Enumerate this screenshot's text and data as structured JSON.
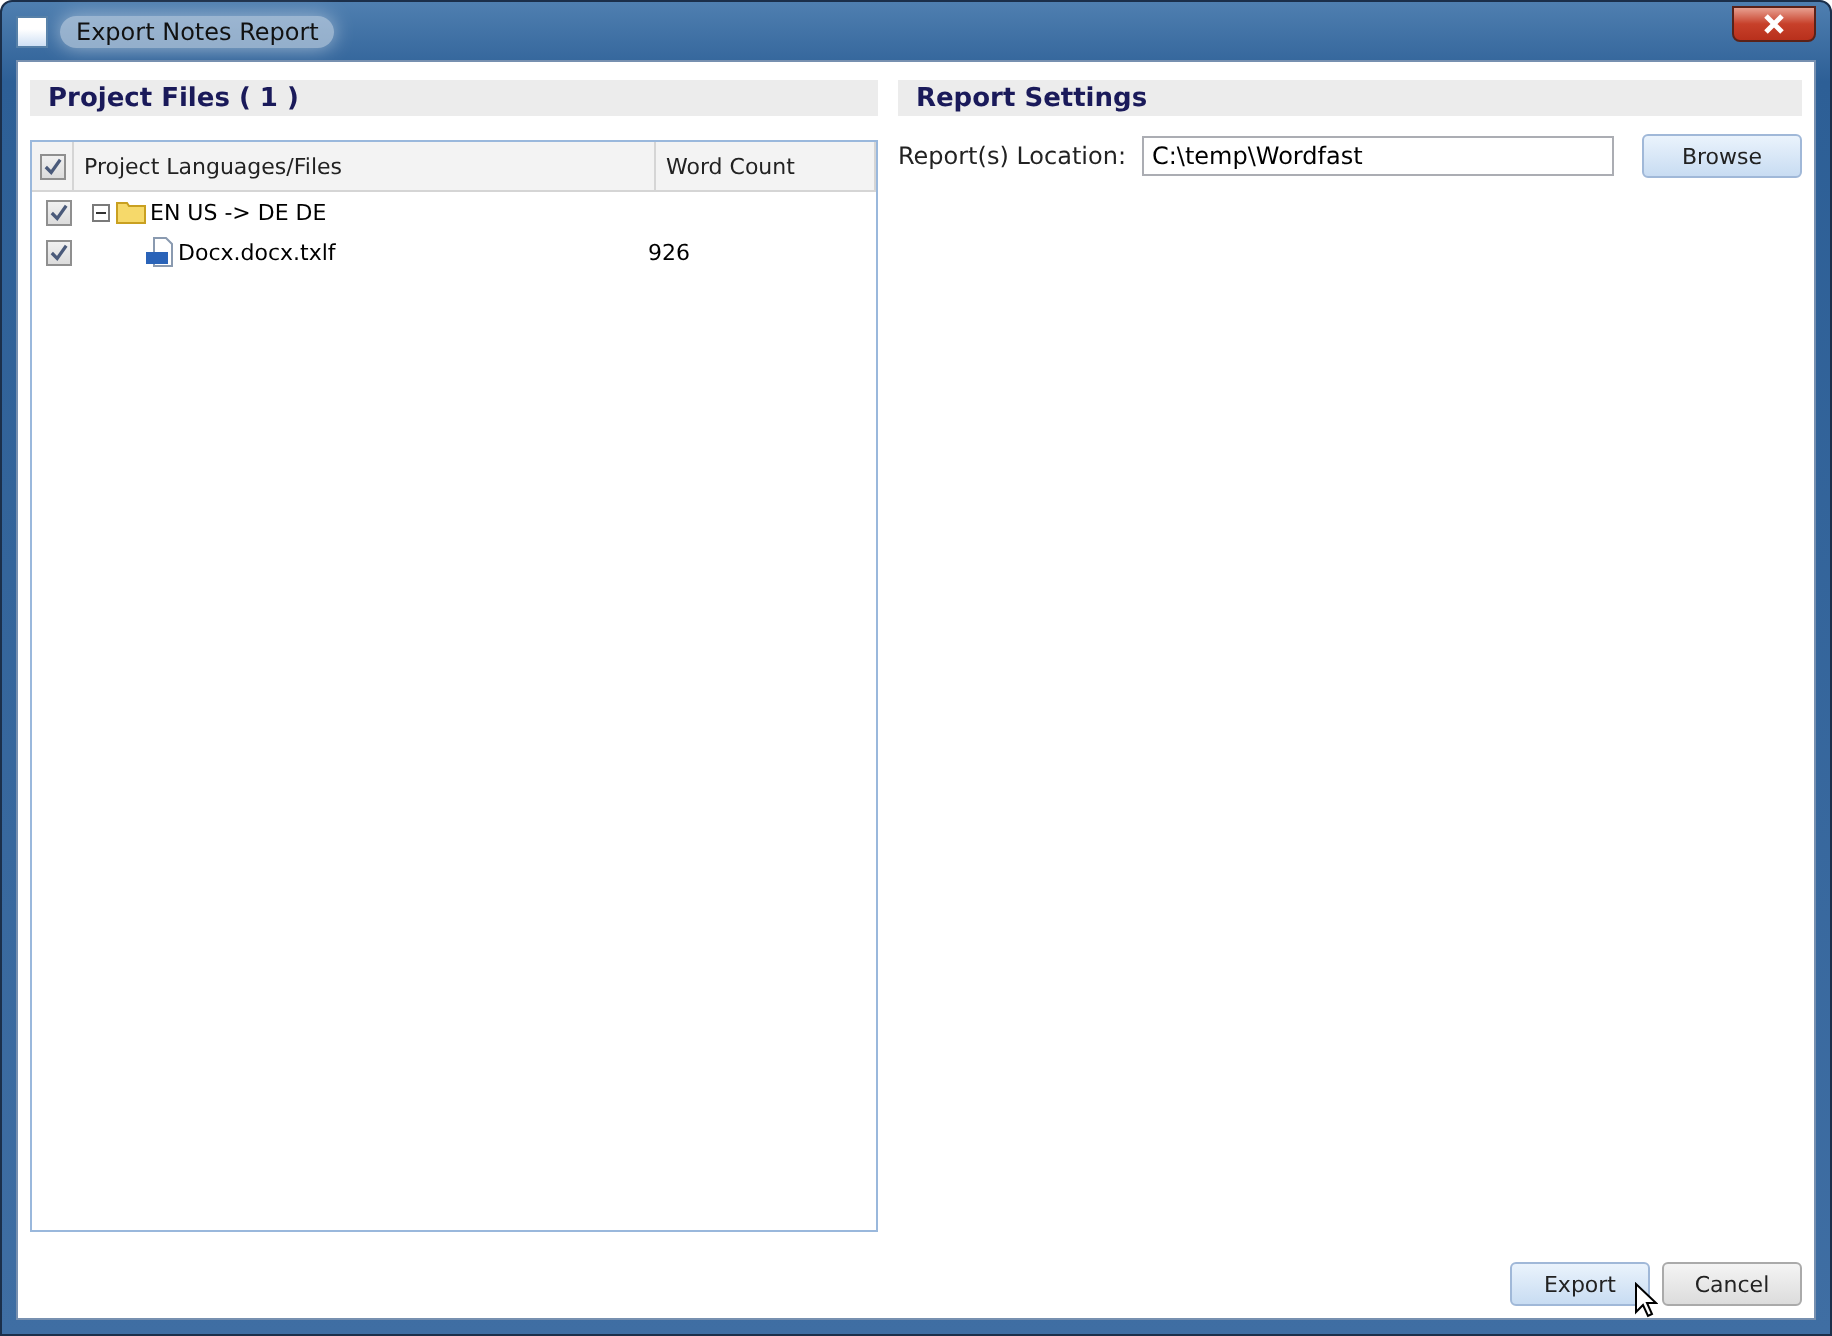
{
  "window": {
    "title": "Export Notes Report"
  },
  "project_files": {
    "title": "Project Files ( 1 )",
    "columns": [
      {
        "label": "Project Languages/Files"
      },
      {
        "label": "Word Count"
      }
    ],
    "all_checked": true,
    "tree": [
      {
        "kind": "folder",
        "label": "EN US -> DE DE",
        "checked": true,
        "expanded": true,
        "children": [
          {
            "kind": "file",
            "label": "Docx.docx.txlf",
            "checked": true,
            "word_count": "926"
          }
        ]
      }
    ]
  },
  "report_settings": {
    "title": "Report Settings",
    "location_label": "Report(s) Location:",
    "location_value": "C:\\temp\\Wordfast",
    "browse": "Browse"
  },
  "buttons": [
    {
      "label": "Export",
      "hovered": true
    },
    {
      "label": "Cancel",
      "hovered": false
    }
  ]
}
